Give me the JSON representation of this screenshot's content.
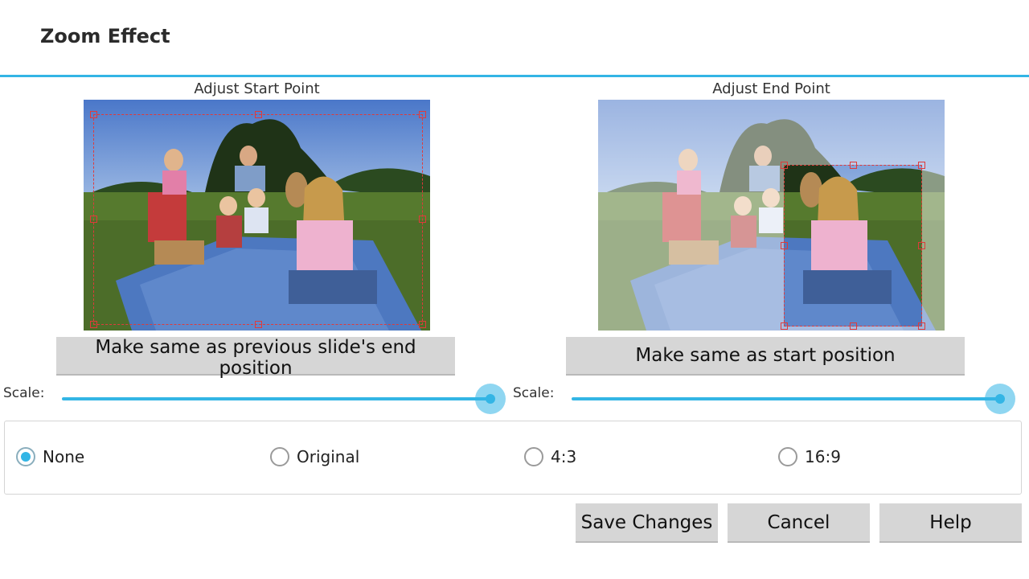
{
  "colors": {
    "accent": "#33b5e5",
    "crop": "#e03a3a"
  },
  "dialog": {
    "title": "Zoom Effect"
  },
  "start_panel": {
    "label": "Adjust Start Point",
    "button_label": "Make same as previous slide's end position",
    "scale_label": "Scale:",
    "scale_fraction": 1.0
  },
  "end_panel": {
    "label": "Adjust End Point",
    "button_label": "Make same as start position",
    "scale_label": "Scale:",
    "scale_fraction": 1.0
  },
  "aspect_options": [
    {
      "label": "None",
      "checked": true
    },
    {
      "label": "Original",
      "checked": false
    },
    {
      "label": "4:3",
      "checked": false
    },
    {
      "label": "16:9",
      "checked": false
    }
  ],
  "actions": {
    "save_label": "Save Changes",
    "cancel_label": "Cancel",
    "help_label": "Help"
  },
  "icons": {
    "photo": "family-picnic-photo",
    "crop_handle": "crop-handle-icon",
    "radio": "radio-button-icon"
  }
}
